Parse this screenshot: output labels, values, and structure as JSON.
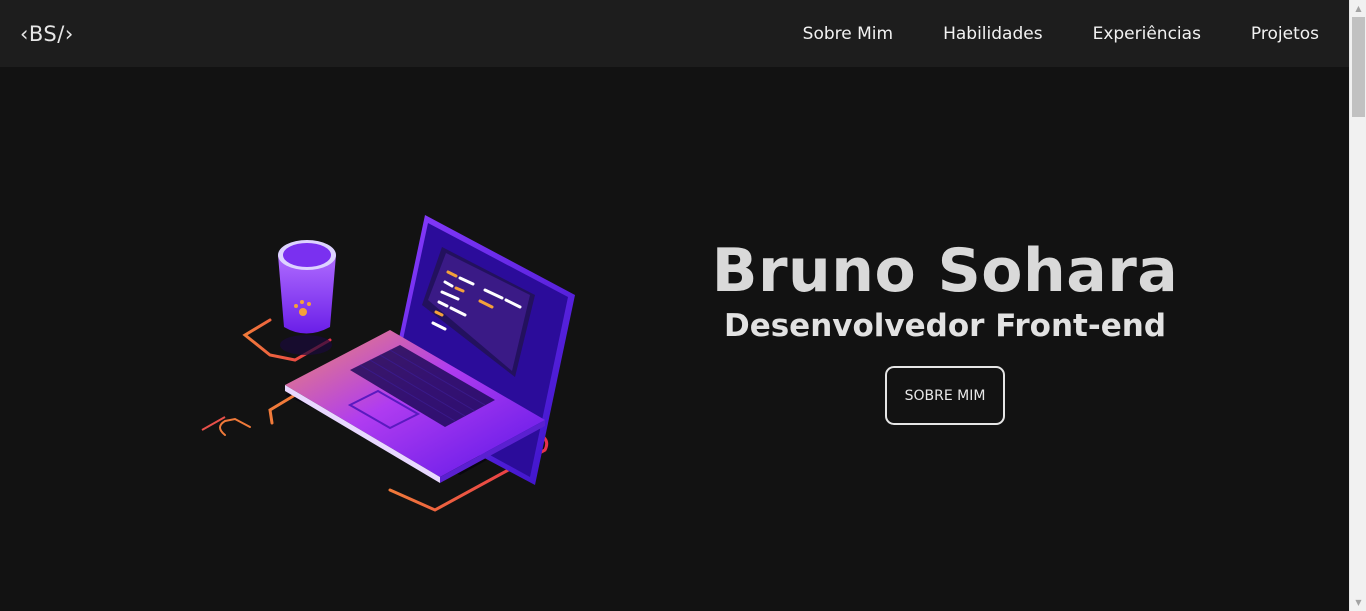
{
  "navbar": {
    "logo": "‹BS/›",
    "links": [
      "Sobre Mim",
      "Habilidades",
      "Experiências",
      "Projetos"
    ]
  },
  "hero": {
    "name": "Bruno Sohara",
    "subtitle": "Desenvolvedor Front-end",
    "button_label": "SOBRE MIM"
  },
  "colors": {
    "background": "#121212",
    "navbar": "#1d1d1d",
    "accent_purple": "#7b2cf0",
    "accent_orange": "#f06a3a"
  },
  "scrollbar": {
    "up_icon": "▲",
    "down_icon": "▼"
  }
}
